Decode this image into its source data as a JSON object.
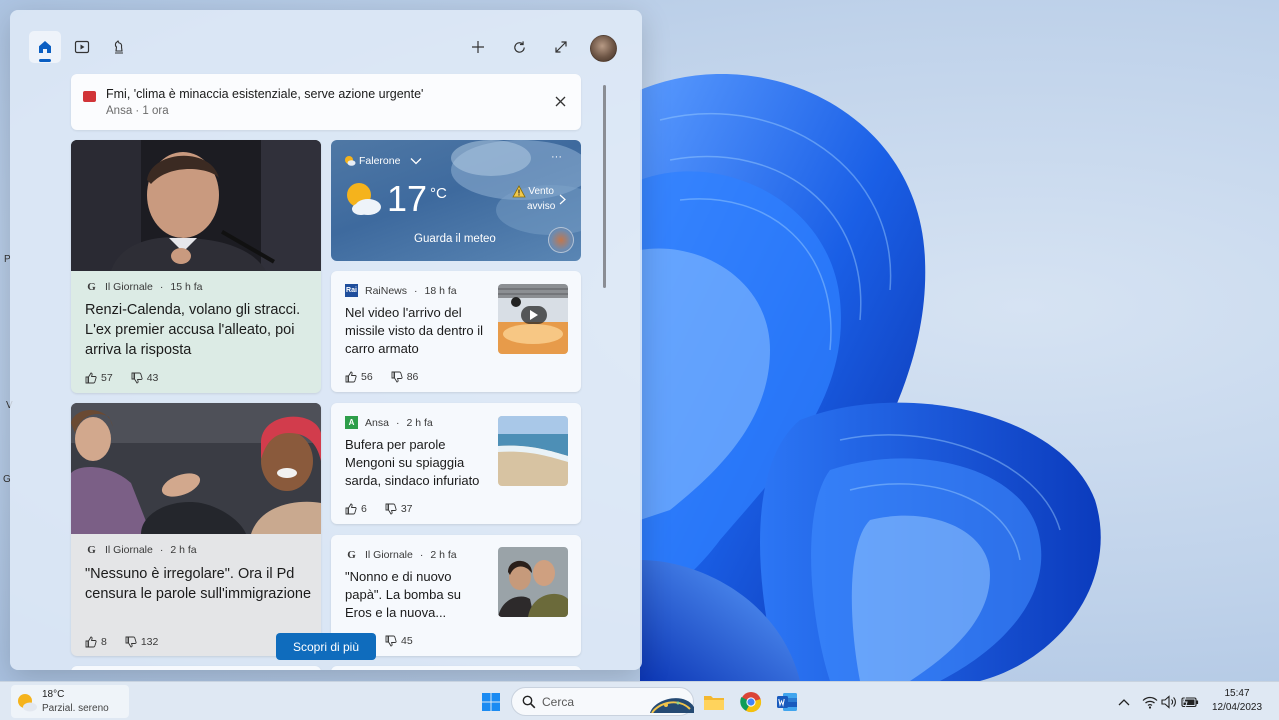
{
  "desktop": {
    "edge_letters": [
      "P",
      "V",
      "G"
    ]
  },
  "widgets": {
    "header": {
      "tabs": [
        {
          "name": "home",
          "icon": "home-icon",
          "active": true
        },
        {
          "name": "video",
          "icon": "play-icon",
          "active": false
        },
        {
          "name": "entertainment",
          "icon": "chess-icon",
          "active": false
        }
      ],
      "actions": [
        "add-icon",
        "refresh-icon",
        "expand-icon"
      ]
    },
    "top_story": {
      "title": "Fmi, 'clima è minaccia esistenziale, serve azione urgente'",
      "meta": "Ansa · 1 ora"
    },
    "weather": {
      "location": "Falerone",
      "temperature": "17",
      "unit": "°C",
      "warning_line1": "Vento",
      "warning_line2": "avviso",
      "cta": "Guarda il meteo",
      "more": "···"
    },
    "cards": [
      {
        "source": "Il Giornale",
        "time": "15 h fa",
        "headline": "Renzi-Calenda, volano gli stracci. L'ex premier accusa l'alleato, poi arriva la risposta",
        "likes": "57",
        "dislikes": "43"
      },
      {
        "source": "RaiNews",
        "time": "18 h fa",
        "headline": "Nel video l'arrivo del missile visto da dentro il carro armato",
        "likes": "56",
        "dislikes": "86"
      },
      {
        "source": "Il Giornale",
        "time": "2 h fa",
        "headline": "\"Nessuno è irregolare\". Ora il Pd censura le parole sull'immigrazione",
        "likes": "8",
        "dislikes": "132"
      },
      {
        "source": "Ansa",
        "time": "2 h fa",
        "headline": "Bufera per parole Mengoni su spiaggia sarda, sindaco infuriato",
        "likes": "6",
        "dislikes": "37"
      },
      {
        "source": "Il Giornale",
        "time": "2 h fa",
        "headline": "\"Nonno e di nuovo papà\". La bomba su Eros e la nuova...",
        "likes": "",
        "dislikes": "45"
      }
    ],
    "discover_button": "Scopri di più"
  },
  "taskbar": {
    "weather": {
      "temp": "18°C",
      "desc": "Parzial. sereno"
    },
    "search_placeholder": "Cerca",
    "pinned": [
      "windows-start-icon",
      "search-icon",
      "file-explorer-icon",
      "chrome-icon",
      "word-icon"
    ],
    "tray": [
      "chevron-up-icon",
      "wifi-icon",
      "speaker-icon",
      "battery-icon"
    ],
    "clock": {
      "time": "15:47",
      "date": "12/04/2023"
    }
  },
  "colors": {
    "accent": "#0f6cbd",
    "warning": "#f2c94c",
    "wallpaper_blue": "#1553d8"
  }
}
